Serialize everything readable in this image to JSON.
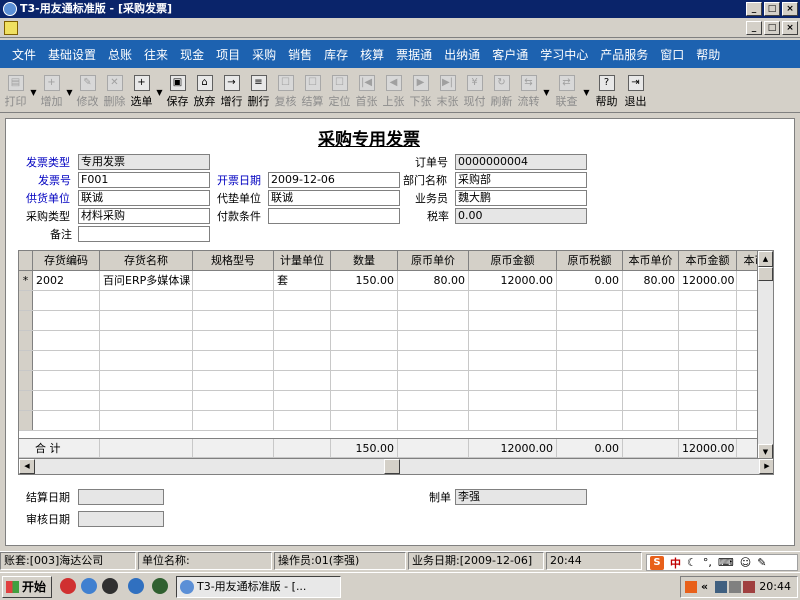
{
  "window": {
    "title": "T3-用友通标准版 - [采购发票]",
    "min_label": "_",
    "max_label": "□",
    "close_label": "×"
  },
  "menu": [
    "文件",
    "基础设置",
    "总账",
    "往来",
    "现金",
    "项目",
    "采购",
    "销售",
    "库存",
    "核算",
    "票据通",
    "出纳通",
    "客户通",
    "学习中心",
    "产品服务",
    "窗口",
    "帮助"
  ],
  "toolbar": {
    "print": "打印",
    "add": "增加",
    "modify": "修改",
    "delete": "删除",
    "select": "选单",
    "save": "保存",
    "abandon": "放弃",
    "add_row": "增行",
    "delete_row": "删行",
    "review": "复核",
    "settle": "结算",
    "locate": "定位",
    "first": "首张",
    "prev": "上张",
    "next": "下张",
    "last": "末张",
    "cash_pay": "现付",
    "refresh": "刷新",
    "flow": "流转",
    "linked_query": "联查",
    "help": "帮助",
    "exit": "退出"
  },
  "form": {
    "title": "采购专用发票",
    "labels": {
      "invoice_type": "发票类型",
      "invoice_no": "发票号",
      "supplier": "供货单位",
      "purchase_type": "采购类型",
      "remark": "备注",
      "invoice_date": "开票日期",
      "agent_unit": "代垫单位",
      "payment_terms": "付款条件",
      "order_no": "订单号",
      "department": "部门名称",
      "salesperson": "业务员",
      "tax_rate": "税率",
      "settle_date": "结算日期",
      "review_date": "审核日期",
      "maker": "制单"
    },
    "values": {
      "invoice_type": "专用发票",
      "invoice_no": "F001",
      "supplier": "联诚",
      "purchase_type": "材料采购",
      "remark": "",
      "invoice_date": "2009-12-06",
      "agent_unit": "联诚",
      "payment_terms": "",
      "order_no": "0000000004",
      "department": "采购部",
      "salesperson": "魏大鹏",
      "tax_rate": "0.00",
      "settle_date": "",
      "review_date": "",
      "maker": "李强"
    }
  },
  "grid": {
    "columns": [
      "存货编码",
      "存货名称",
      "规格型号",
      "计量单位",
      "数量",
      "原币单价",
      "原币金额",
      "原币税额",
      "本币单价",
      "本币金额",
      "本币"
    ],
    "rows": [
      {
        "marker": "*",
        "code": "2002",
        "name": "百问ERP多媒体课",
        "spec": "",
        "unit": "套",
        "qty": "150.00",
        "price": "80.00",
        "amount": "12000.00",
        "tax": "0.00",
        "local_price": "80.00",
        "local_amount": "12000.00",
        "local_tax": ""
      }
    ],
    "total": {
      "label": "合  计",
      "qty": "150.00",
      "amount": "12000.00",
      "tax": "0.00",
      "local_amount": "12000.00"
    }
  },
  "statusbar": {
    "account": "账套:[003]海达公司",
    "unit": "单位名称:",
    "operator": "操作员:01(李强)",
    "business_date": "业务日期:[2009-12-06]",
    "time": "20:44",
    "ime_logo": "S",
    "ime_lang": "中"
  },
  "taskbar": {
    "start": "开始",
    "task_title": "T3-用友通标准版 - [...",
    "tray_chevron": "«",
    "clock": "20:44"
  }
}
